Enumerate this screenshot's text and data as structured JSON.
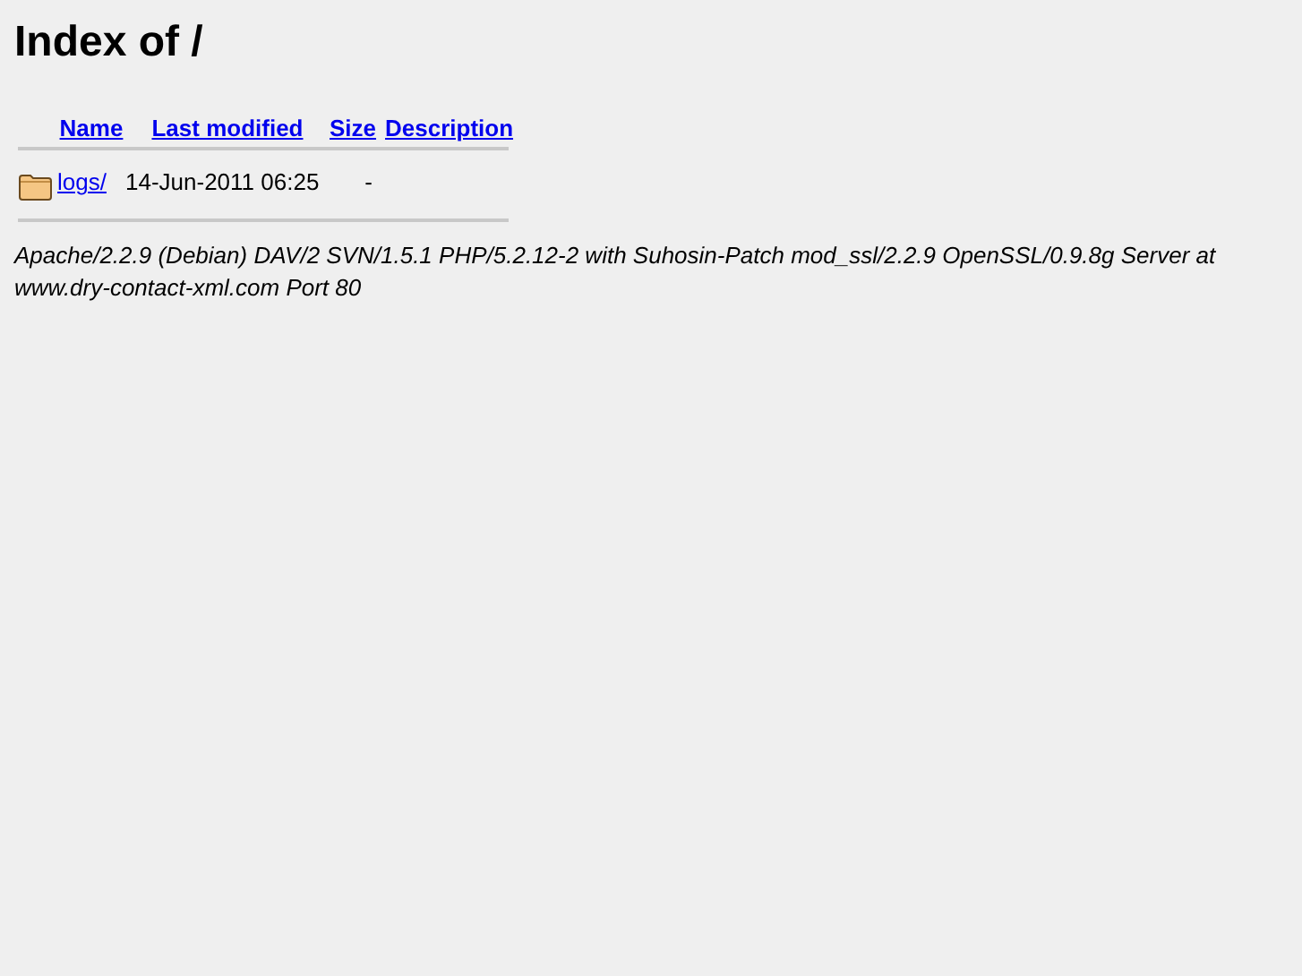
{
  "title": "Index of /",
  "columns": [
    "Name",
    "Last modified",
    "Size",
    "Description"
  ],
  "rows": [
    {
      "kind": "folder",
      "name": "logs/",
      "last_modified": "14-Jun-2011 06:25",
      "size": "-"
    }
  ],
  "address": "Apache/2.2.9 (Debian) DAV/2 SVN/1.5.1 PHP/5.2.12-2 with Suhosin-Patch mod_ssl/2.2.9 OpenSSL/0.9.8g Server at www.dry-contact-xml.com Port 80"
}
